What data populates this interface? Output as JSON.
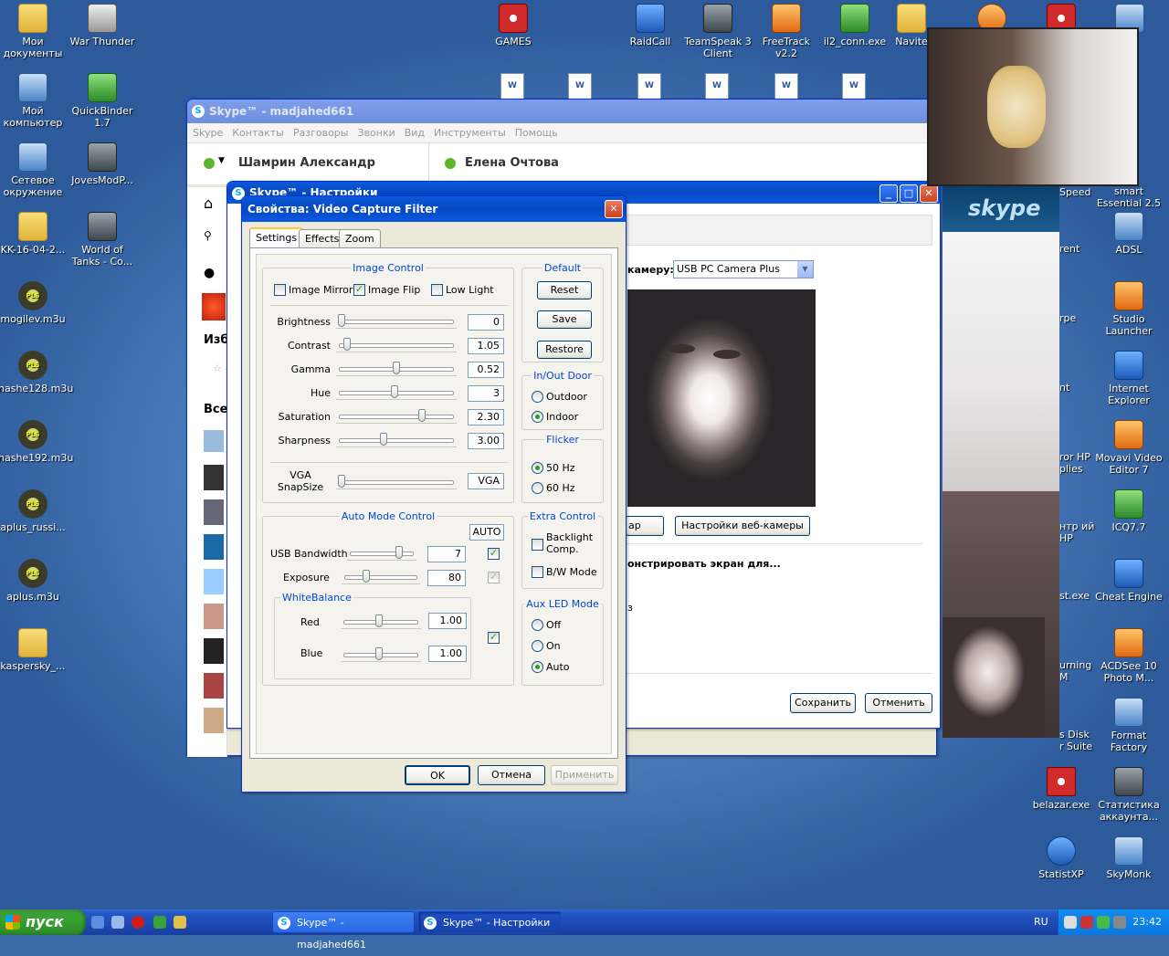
{
  "desktop_icons_left": [
    {
      "label": "Мои документы",
      "icon": "my-documents-icon"
    },
    {
      "label": "Мой компьютер",
      "icon": "my-computer-icon"
    },
    {
      "label": "Сетевое окружение",
      "icon": "network-icon"
    },
    {
      "label": "KK-16-04-2...",
      "icon": "folder-icon"
    },
    {
      "label": "mogilev.m3u",
      "icon": "playlist-icon"
    },
    {
      "label": "nashe128.m3u",
      "icon": "playlist-icon"
    },
    {
      "label": "nashe192.m3u",
      "icon": "playlist-icon"
    },
    {
      "label": "aplus_russi...",
      "icon": "playlist-icon"
    },
    {
      "label": "aplus.m3u",
      "icon": "playlist-icon"
    },
    {
      "label": "kaspersky_...",
      "icon": "folder-icon"
    }
  ],
  "desktop_icons_col2": [
    {
      "label": "War Thunder",
      "icon": "war-thunder-icon"
    },
    {
      "label": "QuickBinder 1.7",
      "icon": "quickbinder-icon"
    },
    {
      "label": "JovesModP...",
      "icon": "wot-icon"
    },
    {
      "label": "World of Tanks - Co...",
      "icon": "wot-icon"
    }
  ],
  "desktop_icons_top": [
    {
      "label": "GAMES",
      "icon": "games-icon"
    },
    {
      "label": "RaidCall",
      "icon": "raidcall-icon"
    },
    {
      "label": "TeamSpeak 3 Client",
      "icon": "teamspeak-icon"
    },
    {
      "label": "FreeTrack v2.2",
      "icon": "freetrack-icon"
    },
    {
      "label": "il2_conn.exe",
      "icon": "il2-icon"
    },
    {
      "label": "Navite",
      "icon": "folder-icon"
    }
  ],
  "desktop_icons_right": [
    {
      "label": "smart Essential 2.5",
      "icon": "smart-icon"
    },
    {
      "label": "ADSL",
      "icon": "adsl-icon"
    },
    {
      "label": "Studio Launcher",
      "icon": "studio-icon"
    },
    {
      "label": "Internet Explorer",
      "icon": "ie-icon"
    },
    {
      "label": "Movavi Video Editor 7",
      "icon": "movavi-icon"
    },
    {
      "label": "ICQ7.7",
      "icon": "icq-icon"
    },
    {
      "label": "Cheat Engine",
      "icon": "cheat-engine-icon"
    },
    {
      "label": "ACDSee 10 Photo M...",
      "icon": "acdsee-icon"
    },
    {
      "label": "Format Factory",
      "icon": "format-factory-icon"
    },
    {
      "label": "Статистика аккаунта...",
      "icon": "stats-icon"
    },
    {
      "label": "SkyMonk",
      "icon": "skymonk-icon"
    }
  ],
  "desktop_icons_right2": [
    {
      "label": "belazar.exe",
      "icon": "belazar-icon"
    },
    {
      "label": "StatistXP",
      "icon": "statistxp-icon"
    }
  ],
  "partial_labels": [
    "Speed",
    "rent",
    "rpe",
    "nt",
    "ror HP plies",
    "нтр ий HP",
    "st.exe",
    "urning M",
    "s Disk r Suite"
  ],
  "skype_main": {
    "title": "Skype™ - madjahed661",
    "menu": [
      "Skype",
      "Контакты",
      "Разговоры",
      "Звонки",
      "Вид",
      "Инструменты",
      "Помощь"
    ],
    "user_name": "Шамрин Александр",
    "contact_name": "Елена Очтова",
    "sidebar_fav": "Изб",
    "sidebar_all": "Все"
  },
  "skype_settings": {
    "title": "Skype™ - Настройки",
    "camera_label": "камеру:",
    "camera_value": "USB PC Camera Plus",
    "webcam_settings_button": "Настройки веб-камеры",
    "partial_button": "ар",
    "show_screen_label": "онстрировать экран для...",
    "save_button": "Сохранить",
    "cancel_button": "Отменить"
  },
  "dialog": {
    "title": "Свойства: Video Capture Filter",
    "tabs": [
      "Settings",
      "Effects",
      "Zoom"
    ],
    "image_control": {
      "title": "Image Control",
      "image_mirror": "Image Mirror",
      "image_mirror_checked": false,
      "image_flip": "Image Flip",
      "image_flip_checked": true,
      "low_light": "Low Light",
      "low_light_checked": false,
      "sliders": [
        {
          "label": "Brightness",
          "value": "0",
          "pos": 0.0
        },
        {
          "label": "Contrast",
          "value": "1.05",
          "pos": 0.05
        },
        {
          "label": "Gamma",
          "value": "0.52",
          "pos": 0.52
        },
        {
          "label": "Hue",
          "value": "3",
          "pos": 0.5
        },
        {
          "label": "Saturation",
          "value": "2.30",
          "pos": 0.76
        },
        {
          "label": "Sharpness",
          "value": "3.00",
          "pos": 0.4
        }
      ],
      "vga_label": "VGA SnapSize",
      "vga_value": "VGA"
    },
    "default": {
      "title": "Default",
      "reset": "Reset",
      "save": "Save",
      "restore": "Restore"
    },
    "inout": {
      "title": "In/Out Door",
      "outdoor": "Outdoor",
      "indoor": "Indoor",
      "selected": "Indoor"
    },
    "flicker": {
      "title": "Flicker",
      "hz50": "50 Hz",
      "hz60": "60 Hz",
      "selected": "50 Hz"
    },
    "auto_mode": {
      "title": "Auto Mode Control",
      "auto": "AUTO",
      "usb_label": "USB Bandwidth",
      "usb_value": "7",
      "usb_pos": 0.85,
      "usb_auto": true,
      "exposure_label": "Exposure",
      "exposure_value": "80",
      "exposure_pos": 0.3,
      "exposure_auto": true,
      "wb_title": "WhiteBalance",
      "red_label": "Red",
      "red_value": "1.00",
      "red_pos": 0.5,
      "blue_label": "Blue",
      "blue_value": "1.00",
      "blue_pos": 0.5,
      "wb_auto": true
    },
    "extra": {
      "title": "Extra Control",
      "backlight": "Backlight Comp.",
      "bw": "B/W Mode"
    },
    "aux_led": {
      "title": "Aux LED Mode",
      "off": "Off",
      "on": "On",
      "auto": "Auto",
      "selected": "Auto"
    },
    "ok": "OK",
    "cancel": "Отмена",
    "apply": "Применить"
  },
  "taskbar": {
    "start": "пуск",
    "tasks": [
      {
        "label": "Skype™ - madjahed661",
        "active": false
      },
      {
        "label": "Skype™ - Настройки",
        "active": true
      }
    ],
    "lang": "RU",
    "time": "23:42"
  },
  "video_overlay": {
    "logo": "skype"
  }
}
